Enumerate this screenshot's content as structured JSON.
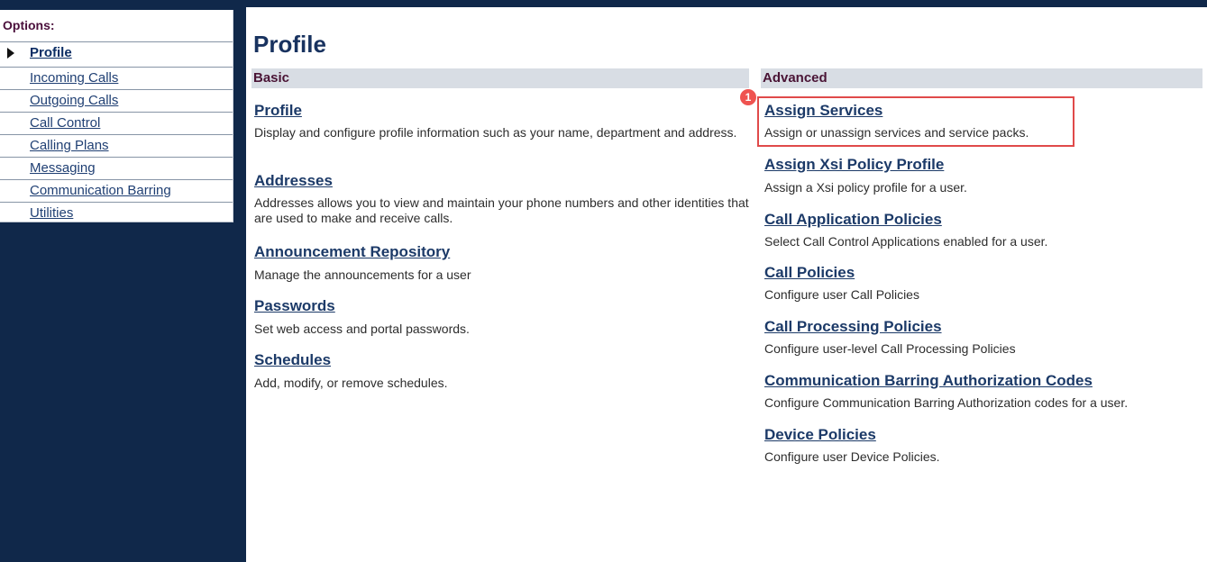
{
  "sidebar": {
    "options_title": "Options:",
    "items": [
      {
        "label": "Profile",
        "active": true
      },
      {
        "label": "Incoming Calls"
      },
      {
        "label": "Outgoing Calls"
      },
      {
        "label": "Call Control"
      },
      {
        "label": "Calling Plans"
      },
      {
        "label": "Messaging"
      },
      {
        "label": "Communication Barring"
      },
      {
        "label": "Utilities"
      }
    ]
  },
  "page": {
    "title": "Profile"
  },
  "basic": {
    "heading": "Basic",
    "items": [
      {
        "title": "Profile",
        "desc": "Display and configure profile information such as your name, department and address."
      },
      {
        "title": "Addresses",
        "desc": "Addresses allows you to view and maintain your phone numbers and other identities that are used to make and receive calls."
      },
      {
        "title": "Announcement Repository",
        "desc": "Manage the announcements for a user"
      },
      {
        "title": "Passwords",
        "desc": "Set web access and portal passwords."
      },
      {
        "title": "Schedules",
        "desc": "Add, modify, or remove schedules."
      }
    ]
  },
  "advanced": {
    "heading": "Advanced",
    "items": [
      {
        "title": "Assign Services",
        "desc": "Assign or unassign services and service packs."
      },
      {
        "title": "Assign Xsi Policy Profile",
        "desc": "Assign a Xsi policy profile for a user."
      },
      {
        "title": "Call Application Policies",
        "desc": "Select Call Control Applications enabled for a user."
      },
      {
        "title": "Call Policies",
        "desc": "Configure user Call Policies"
      },
      {
        "title": "Call Processing Policies",
        "desc": "Configure user-level Call Processing Policies"
      },
      {
        "title": "Communication Barring Authorization Codes",
        "desc": "Configure Communication Barring Authorization codes for a user."
      },
      {
        "title": "Device Policies",
        "desc": "Configure user Device Policies."
      }
    ]
  },
  "annotation": {
    "badge": "1"
  },
  "colors": {
    "navy": "#10284a",
    "link": "#1c3a68",
    "highlight": "#e04a4a"
  }
}
